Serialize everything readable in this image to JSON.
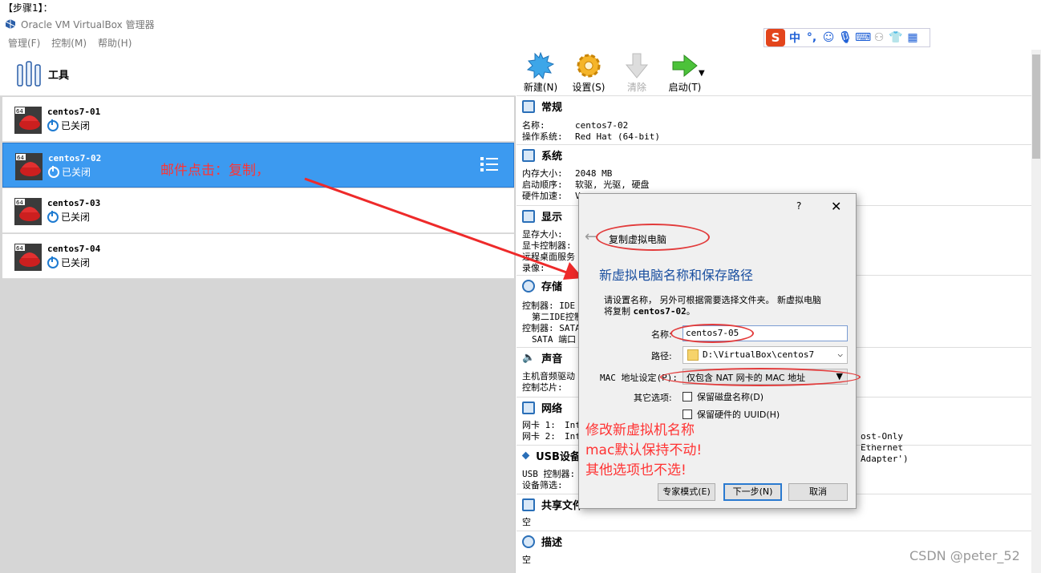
{
  "step_label": "【步骤1】：",
  "window": {
    "title": "Oracle VM VirtualBox 管理器"
  },
  "menu": [
    "管理(F)",
    "控制(M)",
    "帮助(H)"
  ],
  "ime_bar": {
    "icons": [
      "sogou-icon",
      "chinese-mode-icon",
      "punctuation-icon",
      "emoji-icon",
      "voice-icon",
      "keyboard-icon",
      "user-icon",
      "skin-icon",
      "toolbox-icon"
    ],
    "mode_label": "中",
    "punct_label": "°,"
  },
  "tools": {
    "label": "工具"
  },
  "vms": [
    {
      "name": "centos7-01",
      "state": "已关闭",
      "badge": "64"
    },
    {
      "name": "centos7-02",
      "state": "已关闭",
      "badge": "64",
      "selected": true
    },
    {
      "name": "centos7-03",
      "state": "已关闭",
      "badge": "64"
    },
    {
      "name": "centos7-04",
      "state": "已关闭",
      "badge": "64"
    }
  ],
  "annotations": {
    "right_click": "邮件点击：复制，",
    "instructions": [
      "修改新虚拟机名称",
      "mac默认保持不动!",
      "其他选项也不选!"
    ]
  },
  "toolbar": {
    "new": "新建(N)",
    "settings": "设置(S)",
    "discard": "清除",
    "start": "启动(T)"
  },
  "details": {
    "general": {
      "title": "常规",
      "name_key": "名称:",
      "name_val": "centos7-02",
      "os_key": "操作系统:",
      "os_val": "Red Hat (64-bit)"
    },
    "system": {
      "title": "系统",
      "mem_key": "内存大小:",
      "mem_val": "2048 MB",
      "boot_key": "启动顺序:",
      "boot_val": "软驱, 光驱, 硬盘",
      "accel_key": "硬件加速:",
      "accel_val": "V"
    },
    "display": {
      "title": "显示",
      "vram_key": "显存大小:",
      "ctrl_key": "显卡控制器:",
      "rdp_key": "远程桌面服务",
      "rec_key": "录像:"
    },
    "storage": {
      "title": "存储",
      "ide_key": "控制器: IDE",
      "ide2_key": "第二IDE控制",
      "sata_key": "控制器: SATA",
      "sata_port": "SATA 端口"
    },
    "audio": {
      "title": "声音",
      "drv_key": "主机音频驱动",
      "chip_key": "控制芯片:"
    },
    "network": {
      "title": "网络",
      "nic1": "网卡 1:",
      "nic1_val": "Int",
      "nic2": "网卡 2:",
      "nic2_val": "Int",
      "nic2_tail": "ost-Only Ethernet Adapter')"
    },
    "usb": {
      "title": "USB设备",
      "ctrl_key": "USB 控制器:",
      "filter_key": "设备筛选:"
    },
    "shared": {
      "title": "共享文件",
      "val": "空"
    },
    "desc": {
      "title": "描述",
      "val": "空"
    }
  },
  "dialog": {
    "help": "?",
    "close": "✕",
    "title": "复制虚拟电脑",
    "heading": "新虚拟电脑名称和保存路径",
    "desc_line1": "请设置名称， 另外可根据需要选择文件夹。 新虚拟电脑",
    "desc_line2_prefix": "将复制 ",
    "desc_line2_bold": "centos7-02",
    "desc_line2_suffix": "。",
    "name_label": "名称:",
    "name_value": "centos7-05",
    "path_label": "路径:",
    "path_value": "D:\\VirtualBox\\centos7",
    "mac_label": "MAC 地址设定(P):",
    "mac_value": "仅包含 NAT 网卡的 MAC 地址",
    "other_label": "其它选项:",
    "opt_keep_disk": "保留磁盘名称(D)",
    "opt_keep_uuid": "保留硬件的 UUID(H)",
    "btn_expert": "专家模式(E)",
    "btn_next": "下一步(N)",
    "btn_cancel": "取消"
  },
  "watermark": "CSDN @peter_52",
  "colors": {
    "selection": "#3c9af0",
    "annotation": "#ff3333",
    "dialog_heading": "#1a4fa0"
  }
}
